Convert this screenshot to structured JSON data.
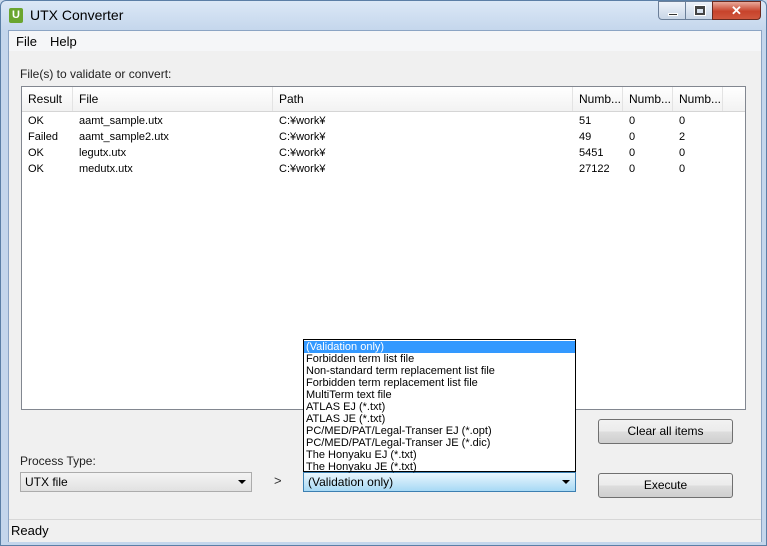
{
  "window": {
    "title": "UTX Converter",
    "icon_letter": "U",
    "close_glyph": "✕"
  },
  "menu": {
    "file": "File",
    "help": "Help"
  },
  "files_label": "File(s) to validate or convert:",
  "table": {
    "columns": [
      "Result",
      "File",
      "Path",
      "Numb...",
      "Numb...",
      "Numb..."
    ],
    "rows": [
      [
        "OK",
        "aamt_sample.utx",
        "C:¥work¥",
        "51",
        "0",
        "0"
      ],
      [
        "Failed",
        "aamt_sample2.utx",
        "C:¥work¥",
        "49",
        "0",
        "2"
      ],
      [
        "OK",
        "legutx.utx",
        "C:¥work¥",
        "5451",
        "0",
        "0"
      ],
      [
        "OK",
        "medutx.utx",
        "C:¥work¥",
        "27122",
        "0",
        "0"
      ]
    ]
  },
  "process_type_label": "Process Type:",
  "process_type_value": "UTX file",
  "arrow_glyph": ">",
  "target": {
    "value": "(Validation only)",
    "options": [
      "(Validation only)",
      "Forbidden term list file",
      "Non-standard term replacement list file",
      "Forbidden term replacement list file",
      "MultiTerm text file",
      "ATLAS EJ (*.txt)",
      "ATLAS JE (*.txt)",
      "PC/MED/PAT/Legal-Transer EJ (*.opt)",
      "PC/MED/PAT/Legal-Transer JE (*.dic)",
      "The Honyaku EJ (*.txt)",
      "The Honyaku JE (*.txt)"
    ],
    "selected_index": 0
  },
  "buttons": {
    "clear_all": "Clear all items",
    "execute": "Execute"
  },
  "status": "Ready"
}
